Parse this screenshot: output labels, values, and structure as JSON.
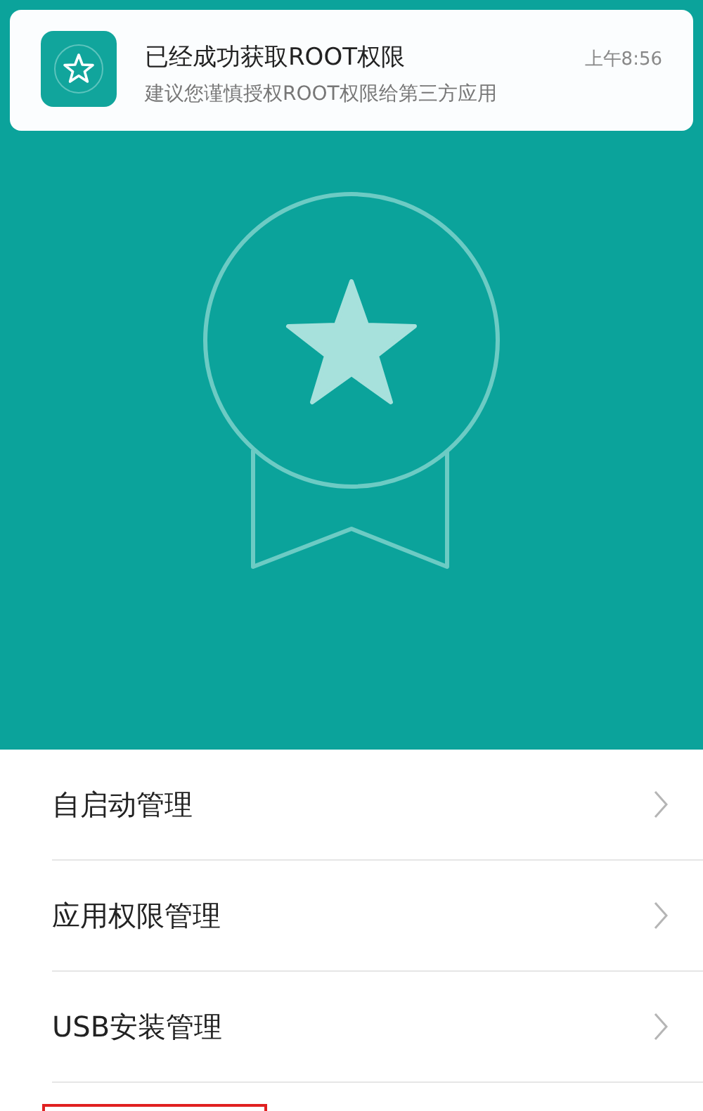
{
  "notification": {
    "title": "已经成功获取ROOT权限",
    "message": "建议您谨慎授权ROOT权限给第三方应用",
    "time": "上午8:56"
  },
  "menu": [
    {
      "label": "自启动管理"
    },
    {
      "label": "应用权限管理"
    },
    {
      "label": "USB安装管理"
    }
  ]
}
